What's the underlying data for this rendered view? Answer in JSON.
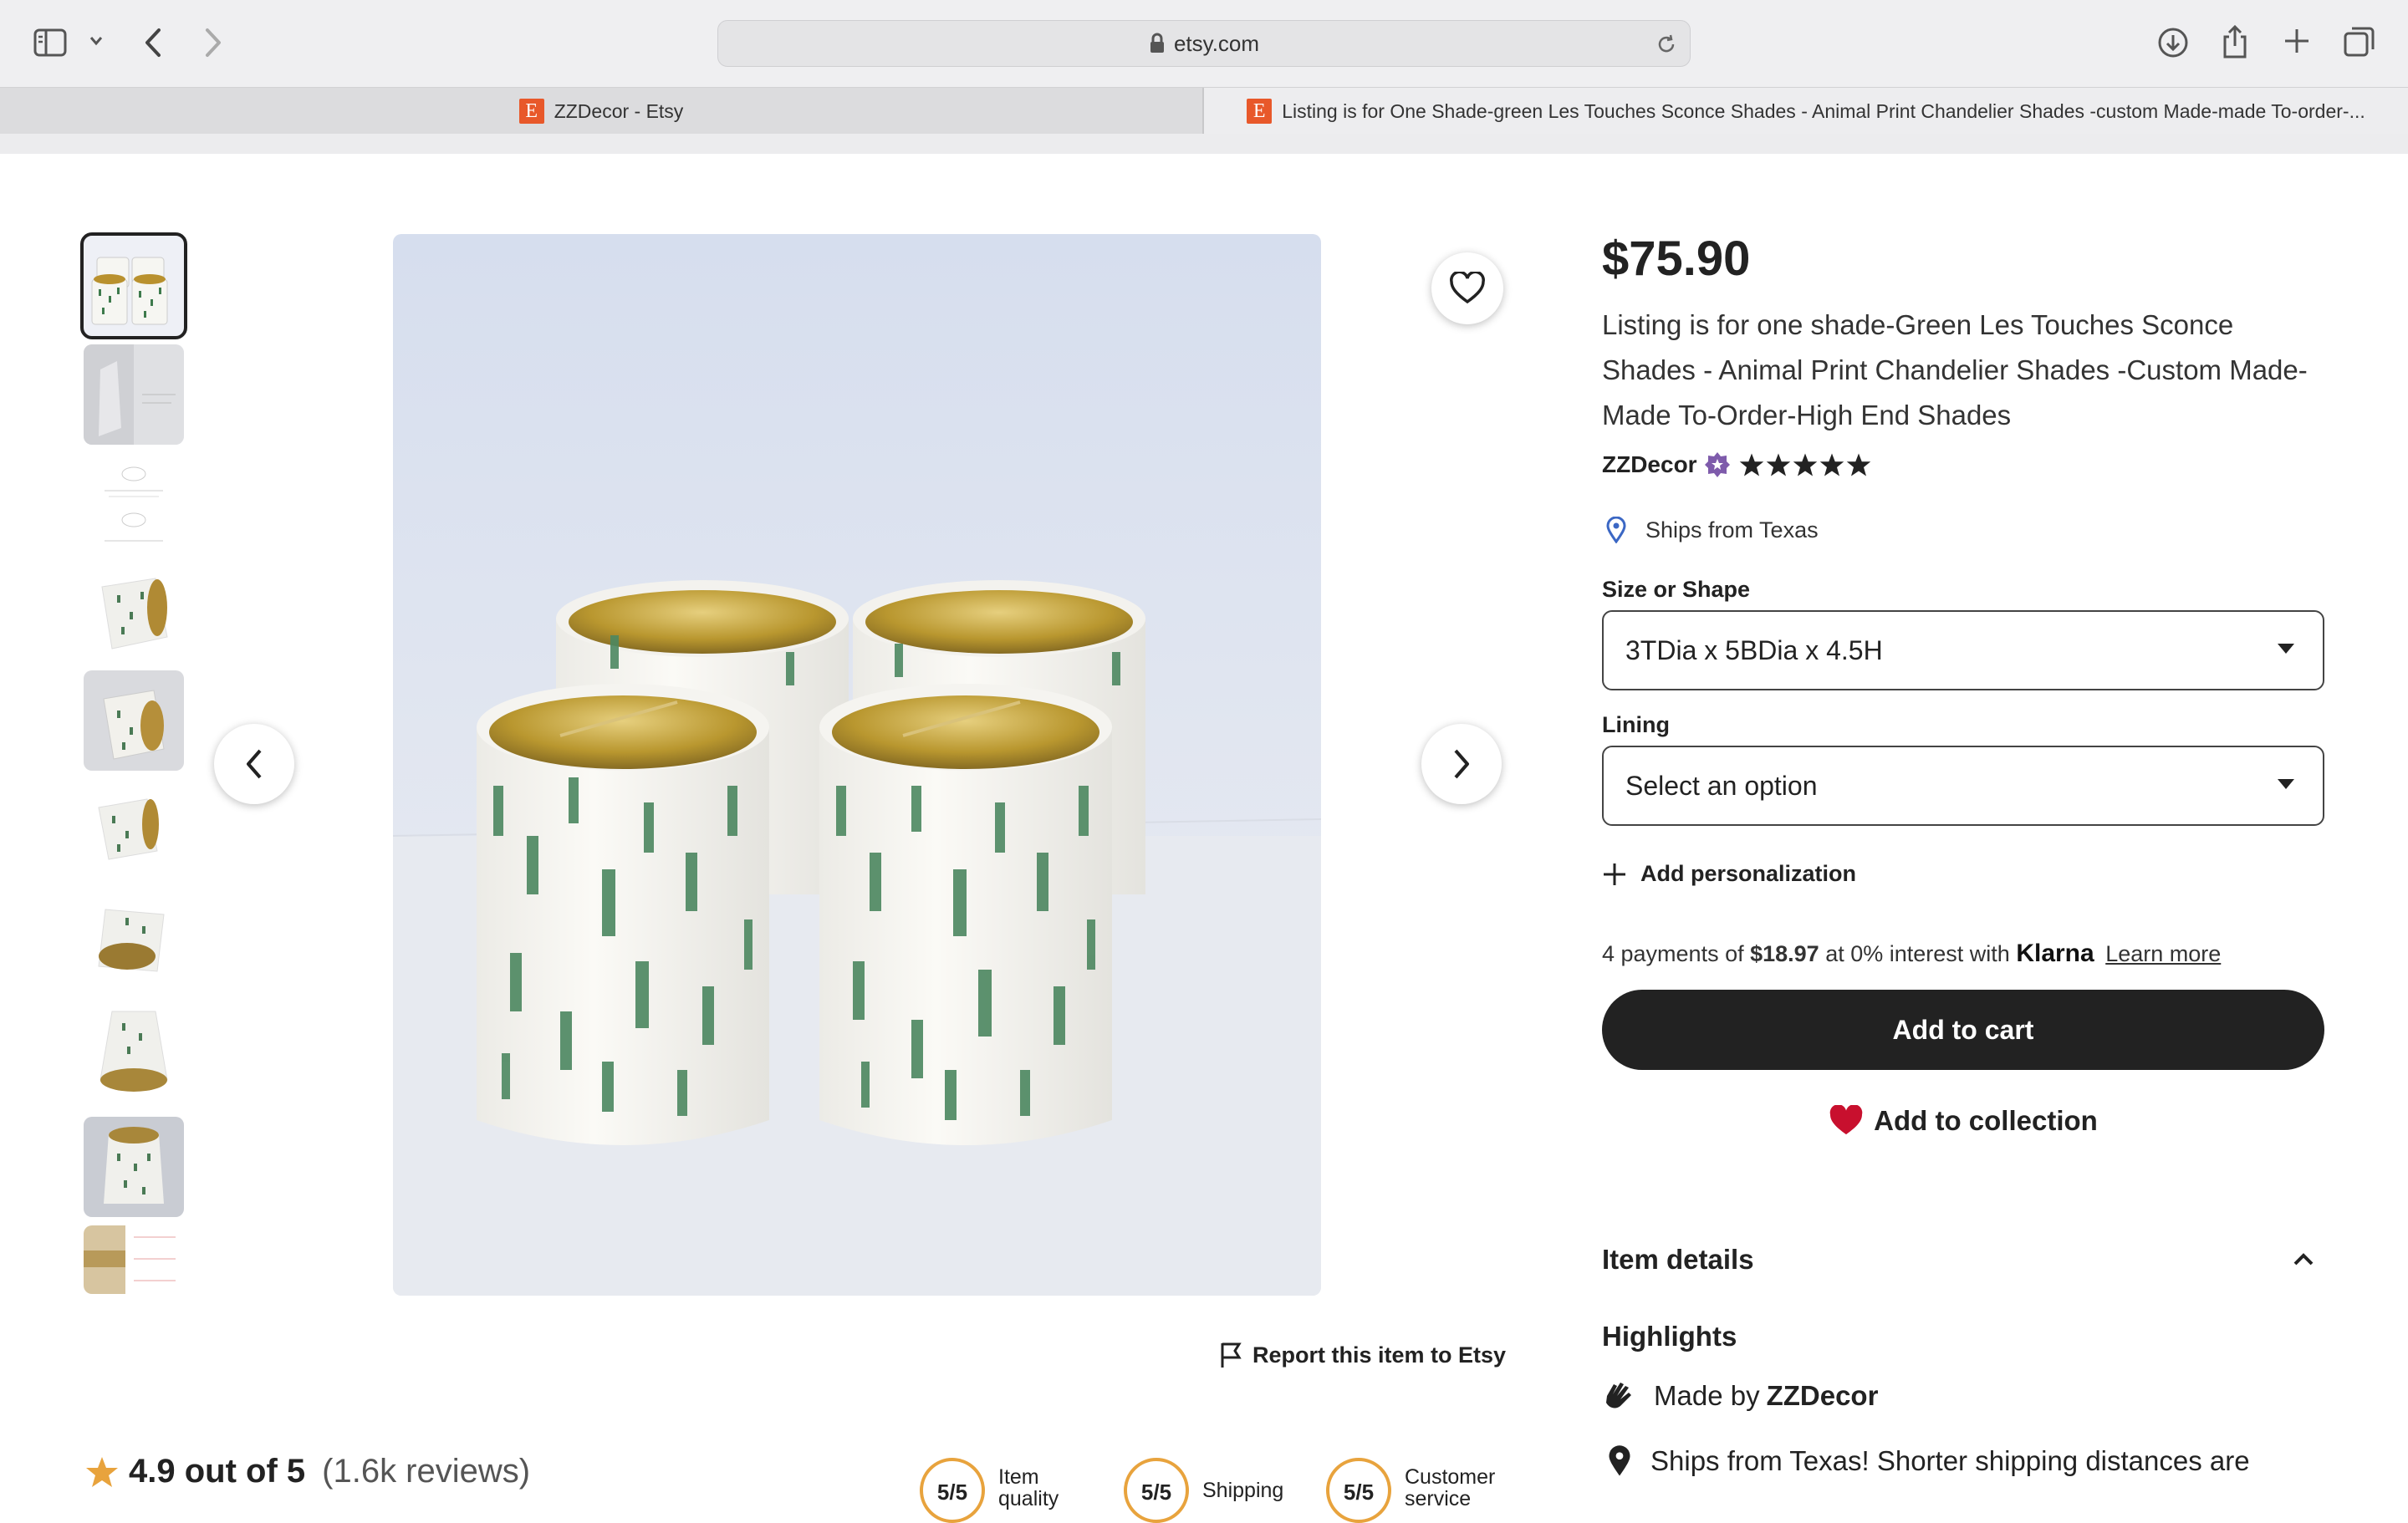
{
  "browser": {
    "url": "etsy.com",
    "tabs": [
      {
        "title": "ZZDecor - Etsy"
      },
      {
        "title": "Listing is for One Shade-green Les Touches Sconce Shades - Animal Print Chandelier Shades -custom Made-made To-order-..."
      }
    ]
  },
  "product": {
    "price": "$75.90",
    "title": "Listing is for one shade-Green Les Touches Sconce Shades - Animal Print Chandelier Shades -Custom Made-Made To-Order-High End Shades",
    "shop_name": "ZZDecor",
    "star_count": 5,
    "ships_from": "Ships from Texas",
    "options": [
      {
        "label": "Size or Shape",
        "value": "3TDia x 5BDia x 4.5H"
      },
      {
        "label": "Lining",
        "value": "Select an option"
      }
    ],
    "personalization": "Add personalization",
    "klarna": {
      "prefix": "4 payments of ",
      "amount": "$18.97",
      "suffix": " at 0% interest with ",
      "brand": "Klarna",
      "learn_more": "Learn more"
    },
    "add_to_cart": "Add to cart",
    "add_to_collection": "Add to collection",
    "item_details": "Item details",
    "highlights_title": "Highlights",
    "made_by_prefix": "Made by ",
    "made_by_shop": "ZZDecor",
    "ships_note": "Ships from Texas! Shorter shipping distances are",
    "report": "Report this item to Etsy"
  },
  "reviews": {
    "rating_text": "4.9 out of 5",
    "count_text": "(1.6k reviews)",
    "scores": [
      {
        "score": "5/5",
        "label": "Item quality"
      },
      {
        "score": "5/5",
        "label": "Shipping"
      },
      {
        "score": "5/5",
        "label": "Customer service"
      }
    ]
  },
  "colors": {
    "accent_orange": "#e8582a",
    "cart_button": "#222222",
    "heart_red": "#c8102e",
    "star_gold": "#e8a33d",
    "star_seller_purple": "#7e5bab",
    "location_blue": "#3b67c4"
  }
}
